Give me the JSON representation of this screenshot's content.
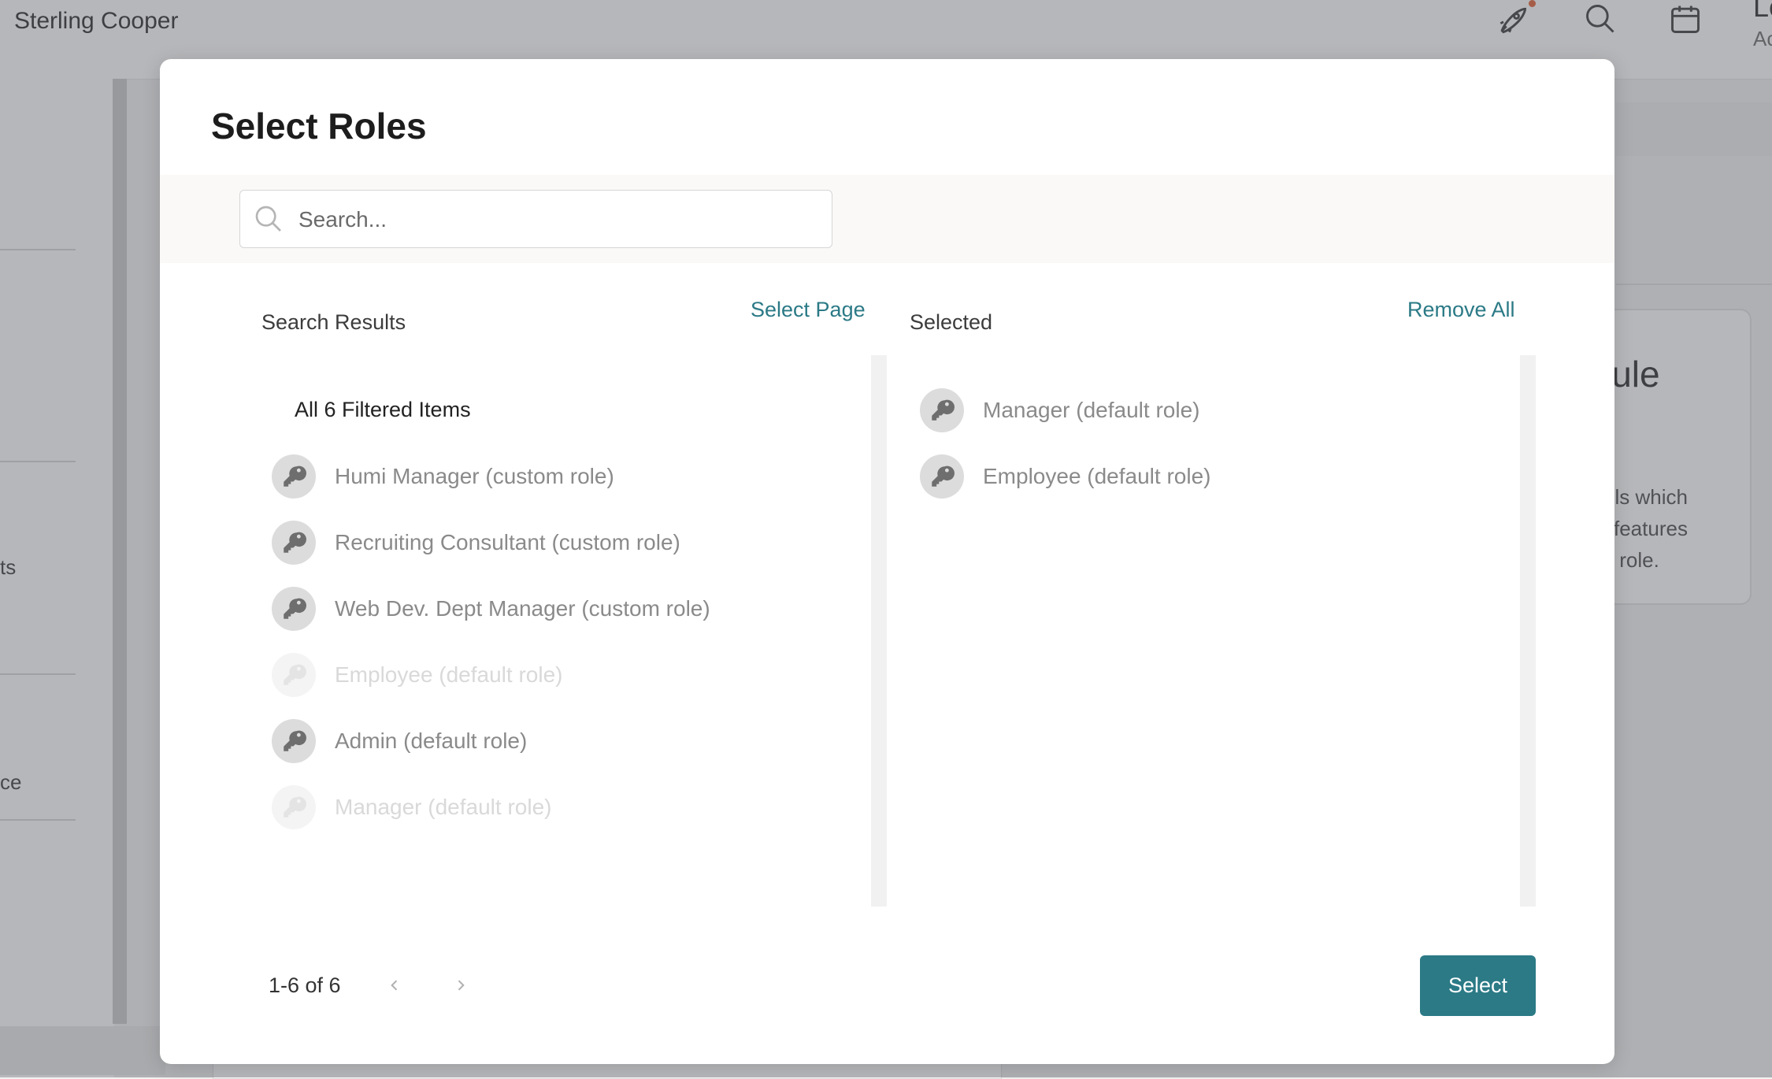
{
  "app": {
    "brand": "Sterling Cooper",
    "icons": [
      "rocket-icon",
      "search-icon",
      "calendar-icon"
    ],
    "user_line_1": "Lo",
    "user_line_2": "Ac"
  },
  "background": {
    "sidebar_fragments": [
      "ts",
      "ce"
    ],
    "card": {
      "title_fragment": "lule",
      "lines": [
        "ols which",
        "l features",
        "s role."
      ]
    }
  },
  "modal": {
    "title": "Select Roles",
    "search": {
      "placeholder": "Search..."
    },
    "results": {
      "header": "Search Results",
      "select_page": "Select Page",
      "filtered_label": "All 6 Filtered Items",
      "items": [
        {
          "label": "Humi Manager (custom role)",
          "disabled": false
        },
        {
          "label": "Recruiting Consultant (custom role)",
          "disabled": false
        },
        {
          "label": "Web Dev. Dept Manager (custom role)",
          "disabled": false
        },
        {
          "label": "Employee (default role)",
          "disabled": true
        },
        {
          "label": "Admin (default role)",
          "disabled": false
        },
        {
          "label": "Manager (default role)",
          "disabled": true
        }
      ]
    },
    "selected": {
      "header": "Selected",
      "remove_all": "Remove All",
      "items": [
        {
          "label": "Manager (default role)"
        },
        {
          "label": "Employee (default role)"
        }
      ]
    },
    "pagination": {
      "range": "1-6 of 6"
    },
    "select_button": "Select"
  },
  "colors": {
    "accent": "#2b7a86",
    "notification_dot": "#e05a2b"
  }
}
